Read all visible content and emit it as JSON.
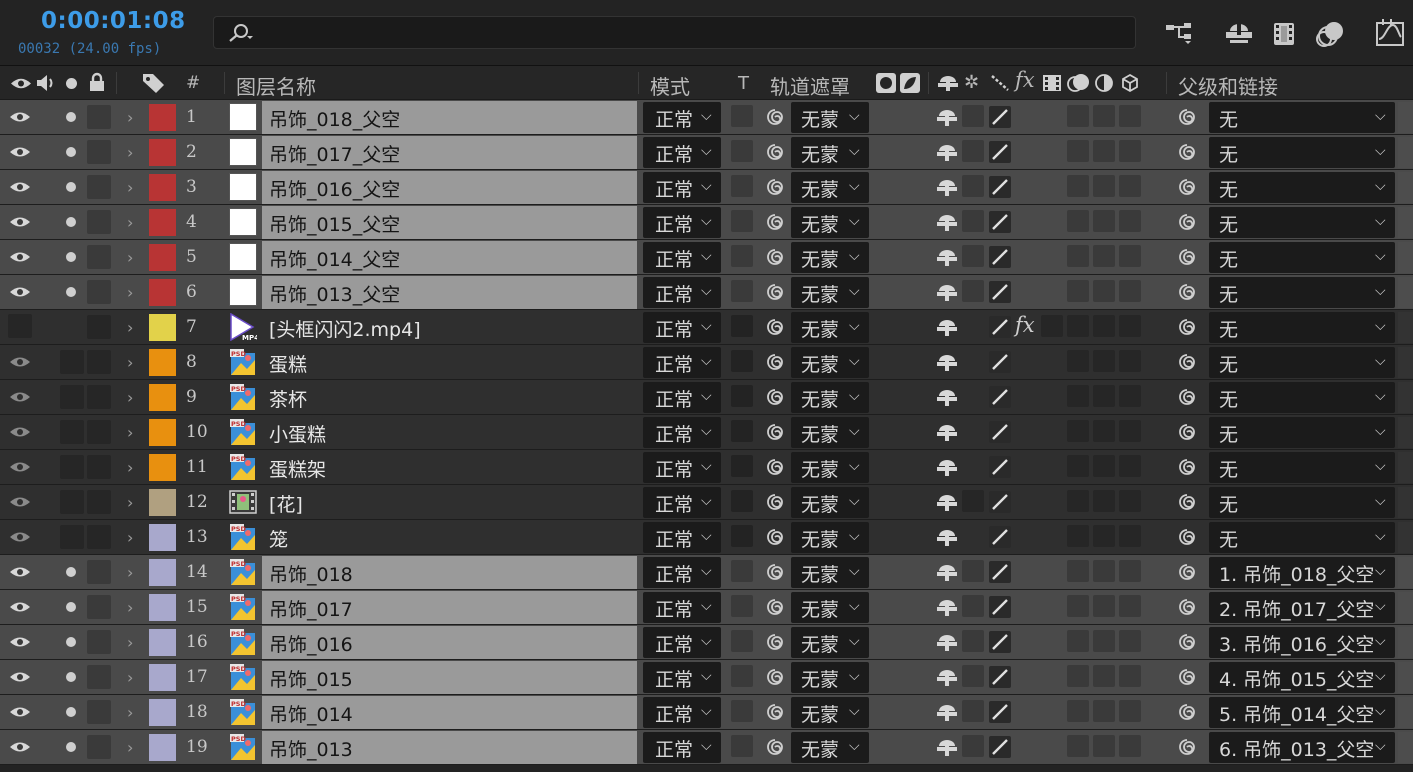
{
  "topbar": {
    "timecode": "0:00:01:08",
    "frames": "00032 (24.00 fps)",
    "search_placeholder": "",
    "icons": [
      "search-icon",
      "composition-flowchart-icon",
      "draft-3d-icon",
      "frame-blending-icon",
      "motion-blur-icon",
      "graph-editor-icon"
    ]
  },
  "header": {
    "layer_name": "图层名称",
    "hash": "#",
    "mode": "模式",
    "t": "T",
    "track_matte": "轨道遮罩",
    "parent": "父级和链接",
    "fx": "fx"
  },
  "colors": {
    "timecode": "#3d9ce8",
    "selected_row": "#4a4a4a",
    "selected_name_bg": "#9a9a9a",
    "label_red": "#b83434",
    "label_yellow": "#e2d24a",
    "label_orange": "#e8900f",
    "label_tan": "#b0a080",
    "label_lavender": "#a8a8cc"
  },
  "layers": [
    {
      "num": "1",
      "name": "吊饰_018_父空",
      "label": "#b83434",
      "type": "null",
      "selected": true,
      "mode": "正常",
      "track": "无蒙",
      "parent": "无",
      "fx": ""
    },
    {
      "num": "2",
      "name": "吊饰_017_父空",
      "label": "#b83434",
      "type": "null",
      "selected": true,
      "mode": "正常",
      "track": "无蒙",
      "parent": "无",
      "fx": ""
    },
    {
      "num": "3",
      "name": "吊饰_016_父空",
      "label": "#b83434",
      "type": "null",
      "selected": true,
      "mode": "正常",
      "track": "无蒙",
      "parent": "无",
      "fx": ""
    },
    {
      "num": "4",
      "name": "吊饰_015_父空",
      "label": "#b83434",
      "type": "null",
      "selected": true,
      "mode": "正常",
      "track": "无蒙",
      "parent": "无",
      "fx": ""
    },
    {
      "num": "5",
      "name": "吊饰_014_父空",
      "label": "#b83434",
      "type": "null",
      "selected": true,
      "mode": "正常",
      "track": "无蒙",
      "parent": "无",
      "fx": ""
    },
    {
      "num": "6",
      "name": "吊饰_013_父空",
      "label": "#b83434",
      "type": "null",
      "selected": true,
      "mode": "正常",
      "track": "无蒙",
      "parent": "无",
      "fx": ""
    },
    {
      "num": "7",
      "name": "[头框闪闪2.mp4]",
      "label": "#e2d24a",
      "type": "mp4",
      "selected": false,
      "mode": "正常",
      "track": "无蒙",
      "parent": "无",
      "fx": "fx",
      "hidden": true
    },
    {
      "num": "8",
      "name": "蛋糕",
      "label": "#e8900f",
      "type": "psd",
      "selected": false,
      "mode": "正常",
      "track": "无蒙",
      "parent": "无",
      "fx": ""
    },
    {
      "num": "9",
      "name": "茶杯",
      "label": "#e8900f",
      "type": "psd",
      "selected": false,
      "mode": "正常",
      "track": "无蒙",
      "parent": "无",
      "fx": ""
    },
    {
      "num": "10",
      "name": "小蛋糕",
      "label": "#e8900f",
      "type": "psd",
      "selected": false,
      "mode": "正常",
      "track": "无蒙",
      "parent": "无",
      "fx": ""
    },
    {
      "num": "11",
      "name": "蛋糕架",
      "label": "#e8900f",
      "type": "psd",
      "selected": false,
      "mode": "正常",
      "track": "无蒙",
      "parent": "无",
      "fx": ""
    },
    {
      "num": "12",
      "name": "[花]",
      "label": "#b0a080",
      "type": "comp",
      "selected": false,
      "mode": "正常",
      "track": "无蒙",
      "parent": "无",
      "fx": ""
    },
    {
      "num": "13",
      "name": "笼",
      "label": "#a8a8cc",
      "type": "psd",
      "selected": false,
      "mode": "正常",
      "track": "无蒙",
      "parent": "无",
      "fx": ""
    },
    {
      "num": "14",
      "name": "吊饰_018",
      "label": "#a8a8cc",
      "type": "psd",
      "selected": true,
      "mode": "正常",
      "track": "无蒙",
      "parent": "1. 吊饰_018_父空",
      "fx": ""
    },
    {
      "num": "15",
      "name": "吊饰_017",
      "label": "#a8a8cc",
      "type": "psd",
      "selected": true,
      "mode": "正常",
      "track": "无蒙",
      "parent": "2. 吊饰_017_父空",
      "fx": ""
    },
    {
      "num": "16",
      "name": "吊饰_016",
      "label": "#a8a8cc",
      "type": "psd",
      "selected": true,
      "mode": "正常",
      "track": "无蒙",
      "parent": "3. 吊饰_016_父空",
      "fx": ""
    },
    {
      "num": "17",
      "name": "吊饰_015",
      "label": "#a8a8cc",
      "type": "psd",
      "selected": true,
      "mode": "正常",
      "track": "无蒙",
      "parent": "4. 吊饰_015_父空",
      "fx": ""
    },
    {
      "num": "18",
      "name": "吊饰_014",
      "label": "#a8a8cc",
      "type": "psd",
      "selected": true,
      "mode": "正常",
      "track": "无蒙",
      "parent": "5. 吊饰_014_父空",
      "fx": ""
    },
    {
      "num": "19",
      "name": "吊饰_013",
      "label": "#a8a8cc",
      "type": "psd",
      "selected": true,
      "mode": "正常",
      "track": "无蒙",
      "parent": "6. 吊饰_013_父空",
      "fx": ""
    }
  ]
}
